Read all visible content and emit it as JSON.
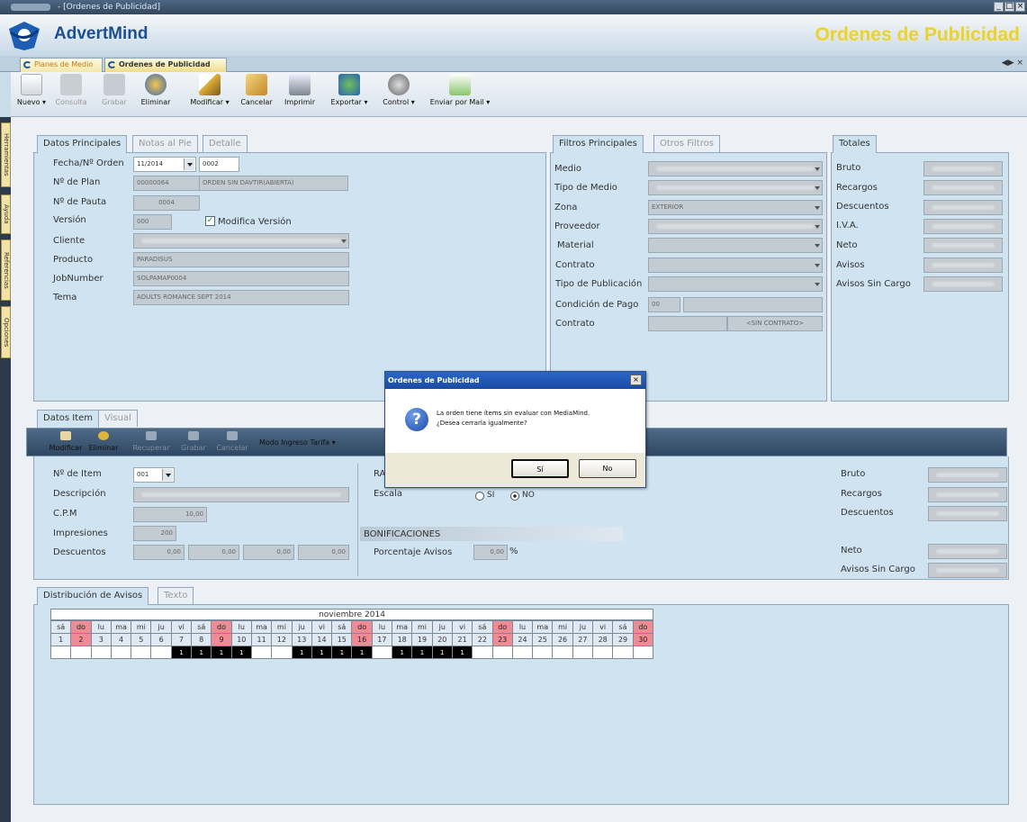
{
  "window": {
    "title": "- [Ordenes de Publicidad]",
    "controls": [
      "_",
      "×"
    ]
  },
  "header": {
    "brand": "AdvertMind",
    "module_title": "Ordenes de Publicidad"
  },
  "doc_tabs": [
    {
      "label": "Planes de Medio"
    },
    {
      "label": "Ordenes de Publicidad"
    }
  ],
  "toolbar": [
    {
      "label": "Nuevo",
      "menu": true,
      "enabled": true
    },
    {
      "label": "Consulta",
      "enabled": false
    },
    {
      "label": "Grabar",
      "enabled": false
    },
    {
      "label": "Eliminar",
      "enabled": true
    },
    {
      "label": "Modificar",
      "menu": true,
      "enabled": true
    },
    {
      "label": "Cancelar",
      "enabled": true
    },
    {
      "label": "Imprimir",
      "enabled": true
    },
    {
      "label": "Exportar",
      "menu": true,
      "enabled": true
    },
    {
      "label": "Control",
      "menu": true,
      "enabled": true
    },
    {
      "label": "Enviar por Mail",
      "menu": true,
      "enabled": true
    }
  ],
  "side_tabs": [
    "Herramientas",
    "Ayuda",
    "Referencias",
    "Opciones"
  ],
  "datos": {
    "tabs": [
      "Datos Principales",
      "Notas al Pie",
      "Detalle"
    ],
    "fecha_label": "Fecha/Nº Orden",
    "fecha_value": "11/2014",
    "orden_value": "0002",
    "plan_label": "Nº de Plan",
    "plan_value": "00000064",
    "plan_desc": "ORDEN SIN DAVTIR(ABIERTA)",
    "pauta_label": "Nº de Pauta",
    "pauta_value": "0004",
    "version_label": "Versión",
    "version_value": "000",
    "modifica_label": "Modifica Versión",
    "cliente_label": "Cliente",
    "producto_label": "Producto",
    "producto_value": "PARADISUS",
    "jobnumber_label": "JobNumber",
    "jobnumber_value": "SOLPAMAP0004",
    "tema_label": "Tema",
    "tema_value": "ADULTS ROMANCE SEPT 2014"
  },
  "filtros": {
    "tabs": [
      "Filtros Principales",
      "Otros Filtros"
    ],
    "medio_label": "Medio",
    "tipo_medio_label": "Tipo de Medio",
    "zona_label": "Zona",
    "zona_value": "EXTERIOR",
    "proveedor_label": "Proveedor",
    "material_label": "Material",
    "contrato_label": "Contrato",
    "tipo_pub_label": "Tipo de Publicación",
    "condicion_label": "Condición de Pago",
    "condicion_value": "00",
    "contrato2_label": "Contrato",
    "contrato2_value": "<SIN CONTRATO>"
  },
  "totales": {
    "tab": "Totales",
    "labels": [
      "Bruto",
      "Recargos",
      "Descuentos",
      "I.V.A.",
      "Neto",
      "Avisos",
      "Avisos Sin Cargo"
    ]
  },
  "item": {
    "tabs": [
      "Datos Item",
      "Visual"
    ],
    "toolbar": [
      {
        "label": "Modificar",
        "enabled": true
      },
      {
        "label": "Eliminar",
        "enabled": true
      },
      {
        "label": "Recuperar",
        "enabled": false
      },
      {
        "label": "Grabar",
        "enabled": false
      },
      {
        "label": "Cancelar",
        "enabled": false
      },
      {
        "label": "Modo Ingreso Tarifa",
        "menu": true,
        "enabled": true
      }
    ],
    "nitem_label": "Nº de Item",
    "nitem_value": "001",
    "descripcion_label": "Descripción",
    "cpm_label": "C.P.M",
    "cpm_value": "10,00",
    "impresiones_label": "Impresiones",
    "impresiones_value": "200",
    "descuentos_label": "Descuentos",
    "descuentos_values": [
      "0,00",
      "0,00",
      "0,00",
      "0,00"
    ],
    "ra_label": "RA",
    "escala_label": "Escala",
    "escala_si": "SI",
    "escala_no": "NO",
    "escala_selected": "NO",
    "bonif_title": "BONIFICACIONES",
    "porcentaje_label": "Porcentaje Avisos",
    "porcentaje_value": "0,00",
    "porcentaje_unit": "%",
    "right_labels": [
      "Bruto",
      "Recargos",
      "Descuentos",
      "Neto",
      "Avisos Sin Cargo"
    ]
  },
  "distribucion": {
    "tabs": [
      "Distribución de Avisos",
      "Texto"
    ],
    "month": "noviembre 2014",
    "weekdays": [
      "sá",
      "do",
      "lu",
      "ma",
      "mi",
      "ju",
      "vi",
      "sá",
      "do",
      "lu",
      "ma",
      "mi",
      "ju",
      "vi",
      "sá",
      "do",
      "lu",
      "ma",
      "mi",
      "ju",
      "vi",
      "sá",
      "do",
      "lu",
      "ma",
      "mi",
      "ju",
      "vi",
      "sá",
      "do"
    ],
    "days": [
      1,
      2,
      3,
      4,
      5,
      6,
      7,
      8,
      9,
      10,
      11,
      12,
      13,
      14,
      15,
      16,
      17,
      18,
      19,
      20,
      21,
      22,
      23,
      24,
      25,
      26,
      27,
      28,
      29,
      30
    ],
    "weekend_cols": [
      2,
      9,
      16,
      23,
      30
    ],
    "avisos": [
      "",
      "",
      "",
      "",
      "",
      "",
      "1",
      "1",
      "1",
      "1",
      "",
      "",
      "1",
      "1",
      "1",
      "1",
      "",
      "1",
      "1",
      "1",
      "1",
      "",
      "",
      "",
      "",
      "",
      "",
      "",
      "",
      ""
    ]
  },
  "dialog": {
    "title": "Ordenes de Publicidad",
    "icon": "question-icon",
    "message_line1": "La orden tiene ítems sin evaluar con MediaMind.",
    "message_line2": "¿Desea cerrarla igualmente?",
    "yes": "Sí",
    "no": "No"
  },
  "colors": {
    "accent": "#1c4f8f",
    "panel": "#cfe3f1",
    "weekend": "#f08a95",
    "title_gold": "#e7d23b"
  }
}
